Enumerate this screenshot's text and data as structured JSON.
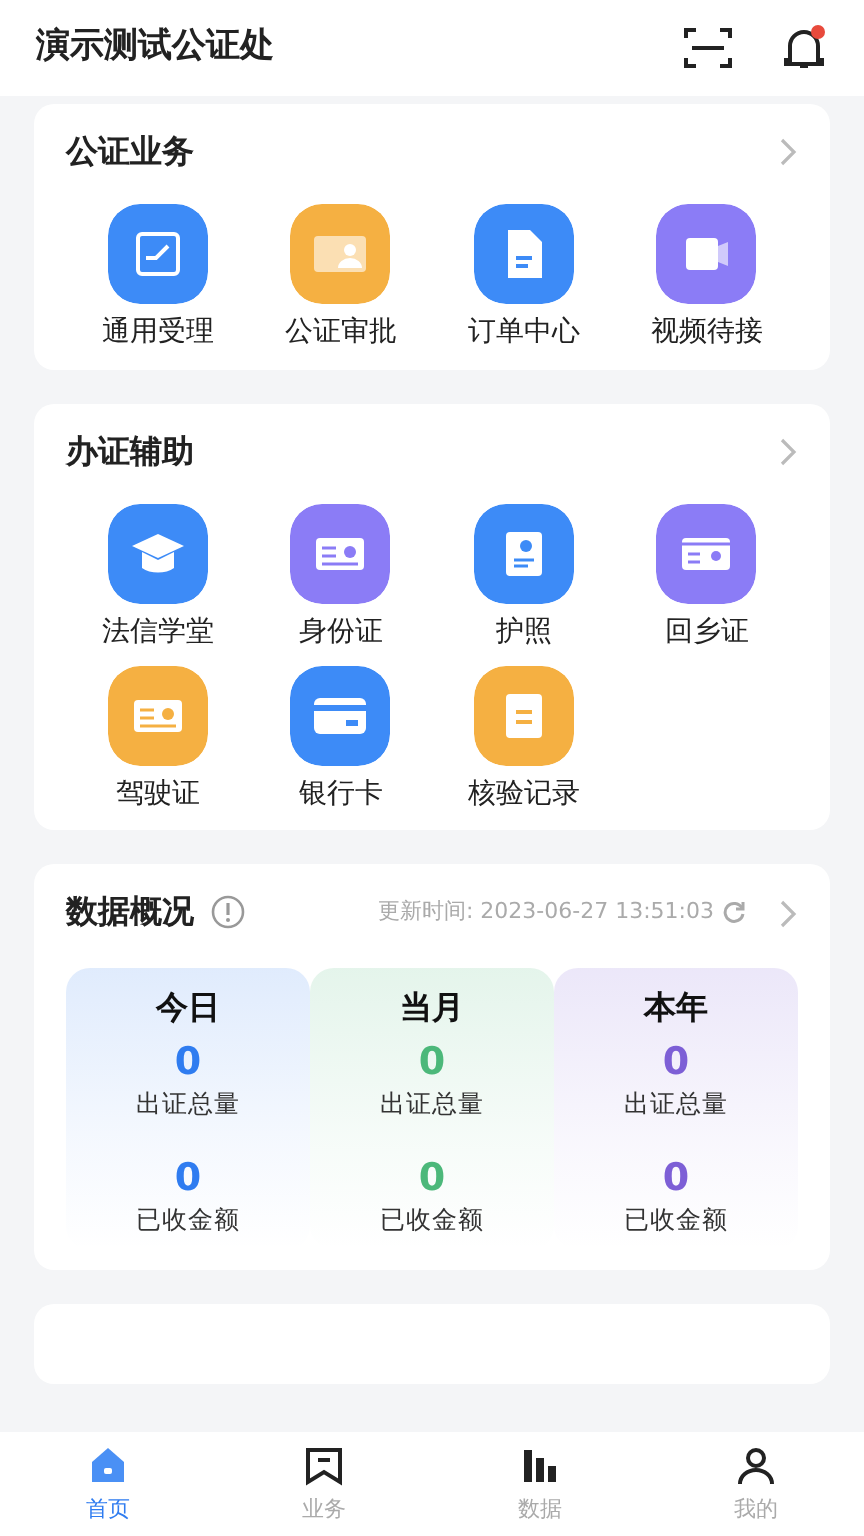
{
  "header": {
    "title": "演示测试公证处",
    "bell_unread": true
  },
  "sections": [
    {
      "title": "公证业务",
      "items": [
        {
          "label": "通用受理",
          "color": "#3d8bf7"
        },
        {
          "label": "公证审批",
          "color": "#f5b042"
        },
        {
          "label": "订单中心",
          "color": "#3d8bf7"
        },
        {
          "label": "视频待接",
          "color": "#8b7cf6"
        }
      ]
    },
    {
      "title": "办证辅助",
      "items": [
        {
          "label": "法信学堂",
          "color": "#3d8bf7"
        },
        {
          "label": "身份证",
          "color": "#8b7cf6"
        },
        {
          "label": "护照",
          "color": "#3d8bf7"
        },
        {
          "label": "回乡证",
          "color": "#8b7cf6"
        },
        {
          "label": "驾驶证",
          "color": "#f5b042"
        },
        {
          "label": "银行卡",
          "color": "#3d8bf7"
        },
        {
          "label": "核验记录",
          "color": "#f5b042"
        }
      ]
    }
  ],
  "overview": {
    "title": "数据概况",
    "updated": "更新时间: 2023-06-27 13:51:03",
    "columns": [
      {
        "period": "今日",
        "color": "#2f7cf0",
        "count": "0",
        "count_label": "出证总量",
        "amount": "0",
        "amount_label": "已收金额"
      },
      {
        "period": "当月",
        "color": "#4cb87a",
        "count": "0",
        "count_label": "出证总量",
        "amount": "0",
        "amount_label": "已收金额"
      },
      {
        "period": "本年",
        "color": "#7d5fd6",
        "count": "0",
        "count_label": "出证总量",
        "amount": "0",
        "amount_label": "已收金额"
      }
    ]
  },
  "tabs": [
    {
      "label": "首页",
      "selected": true
    },
    {
      "label": "业务",
      "selected": false
    },
    {
      "label": "数据",
      "selected": false
    },
    {
      "label": "我的",
      "selected": false
    }
  ]
}
